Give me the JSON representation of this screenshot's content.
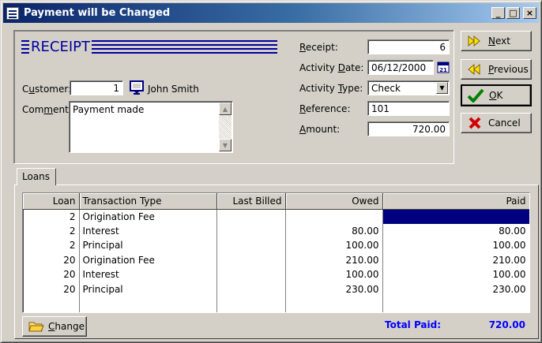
{
  "window": {
    "title": "Payment will be Changed",
    "minimize": "_",
    "maximize": "□",
    "close": "×"
  },
  "header": {
    "logo_text": "RECEIPT"
  },
  "customer": {
    "label_pre": "C",
    "label_u": "u",
    "label_post": "stomer:",
    "id": "1",
    "name": "John Smith"
  },
  "comment": {
    "label_pre": "Com",
    "label_u": "m",
    "label_post": "ent:",
    "value": "Payment made"
  },
  "fields": {
    "receipt": {
      "label_pre": "",
      "label_u": "R",
      "label_post": "eceipt:",
      "value": "6"
    },
    "activity_date": {
      "label_pre": "Activity ",
      "label_u": "D",
      "label_post": "ate:",
      "value": "06/12/2000",
      "calendar_day": "21"
    },
    "activity_type": {
      "label_pre": "Activity ",
      "label_u": "T",
      "label_post": "ype:",
      "value": "Check"
    },
    "reference": {
      "label_pre": "",
      "label_u": "R",
      "label_post": "eference:",
      "value": "101"
    },
    "amount": {
      "label_pre": "",
      "label_u": "A",
      "label_post": "mount:",
      "value": "720.00"
    }
  },
  "buttons": {
    "next": {
      "label_u": "N",
      "label_post": "ext"
    },
    "previous": {
      "label_u": "P",
      "label_post": "revious"
    },
    "ok": {
      "label_u": "O",
      "label_post": "K"
    },
    "cancel": {
      "label_u": "",
      "label_post": "Cancel"
    },
    "change": {
      "label_u": "C",
      "label_post": "hange"
    }
  },
  "tabs": [
    {
      "label": "Loans"
    }
  ],
  "grid": {
    "columns": [
      "Loan",
      "Transaction Type",
      "Last Billed",
      "Owed",
      "Paid"
    ],
    "rows": [
      {
        "loan": "2",
        "type": "Origination Fee",
        "last_billed": "",
        "owed": "",
        "paid": ""
      },
      {
        "loan": "2",
        "type": "Interest",
        "last_billed": "",
        "owed": "80.00",
        "paid": "80.00"
      },
      {
        "loan": "2",
        "type": "Principal",
        "last_billed": "",
        "owed": "100.00",
        "paid": "100.00"
      },
      {
        "loan": "20",
        "type": "Origination Fee",
        "last_billed": "",
        "owed": "210.00",
        "paid": "210.00"
      },
      {
        "loan": "20",
        "type": "Interest",
        "last_billed": "",
        "owed": "100.00",
        "paid": "100.00"
      },
      {
        "loan": "20",
        "type": "Principal",
        "last_billed": "",
        "owed": "230.00",
        "paid": "230.00"
      }
    ]
  },
  "totals": {
    "label": "Total Paid:",
    "value": "720.00"
  },
  "colors": {
    "title_gradient_start": "#0a246a",
    "accent_blue": "#0000a0",
    "selection": "#000080",
    "total_text": "#0000ff"
  }
}
